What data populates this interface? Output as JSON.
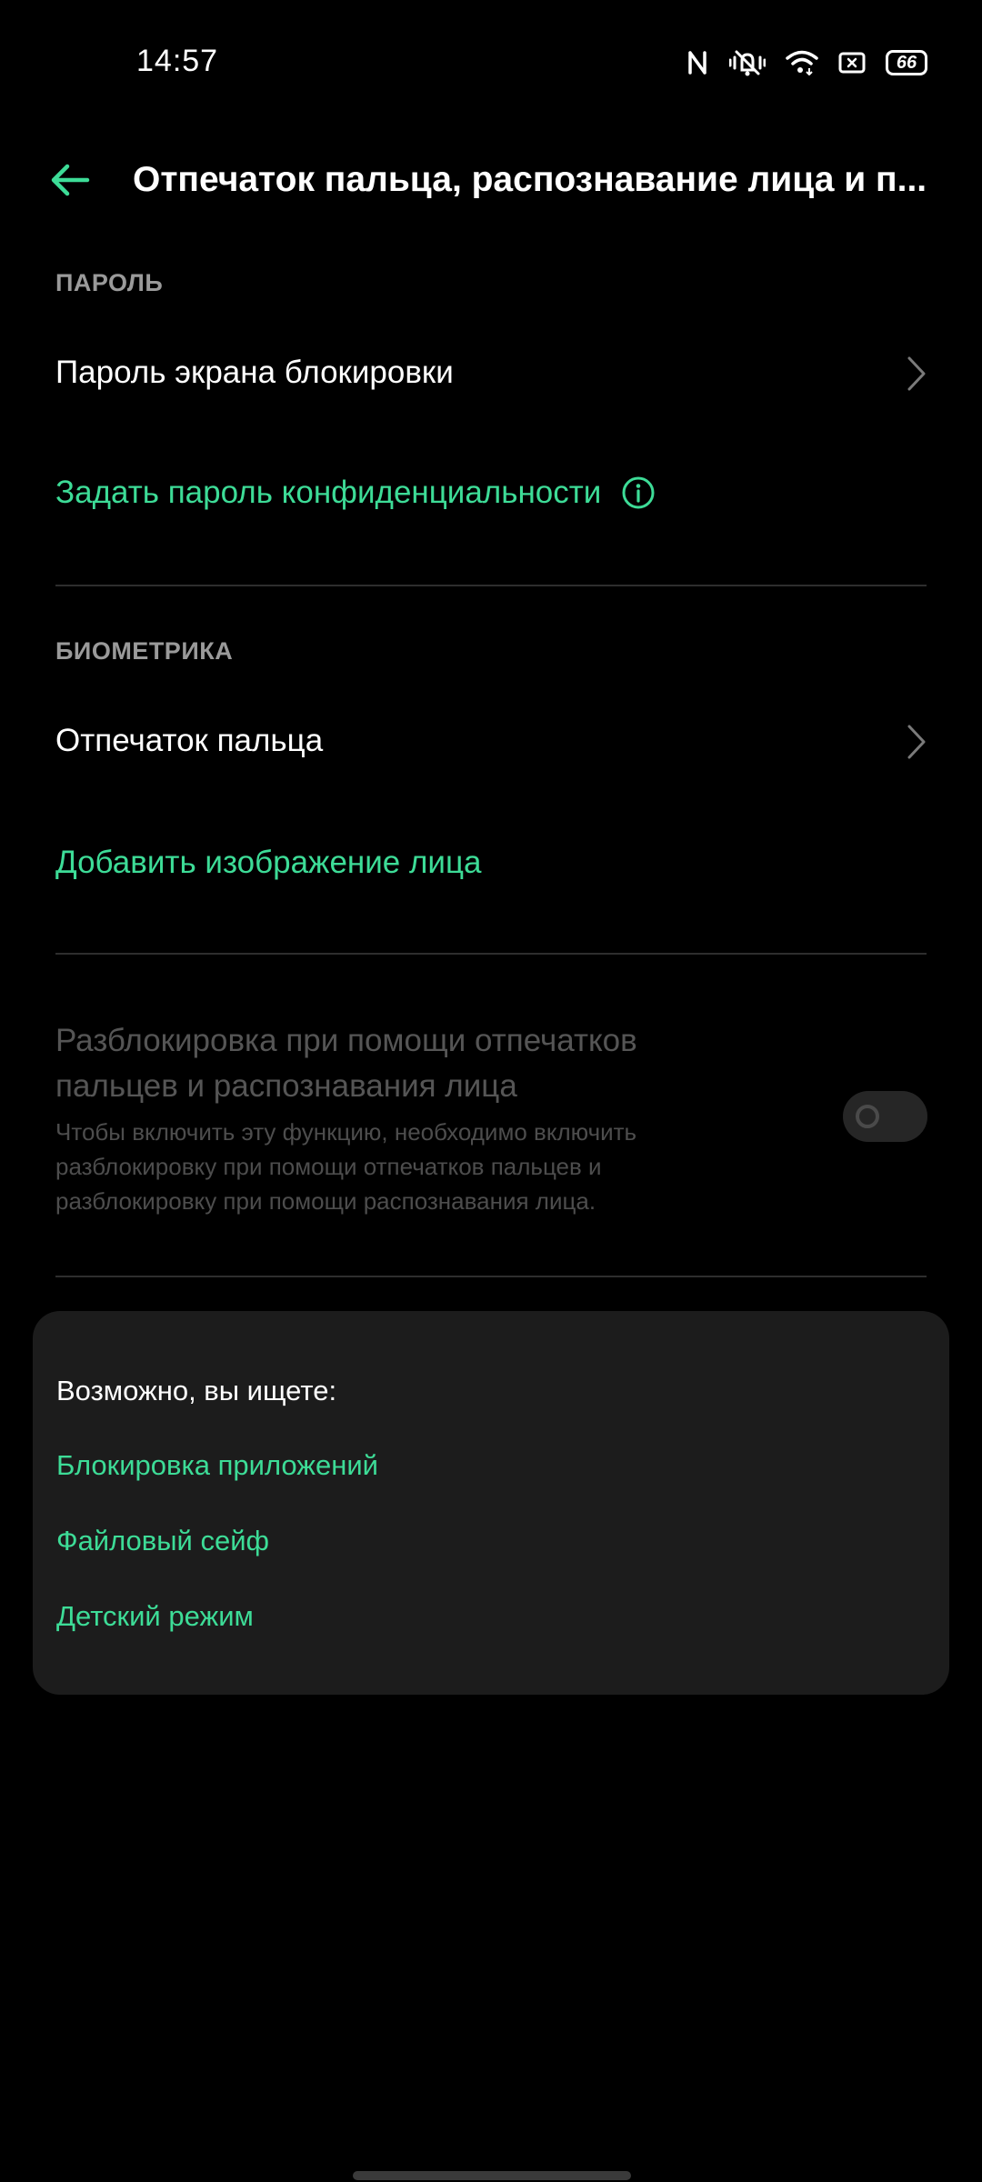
{
  "status_bar": {
    "time": "14:57",
    "battery": "66",
    "icons": [
      "nfc-icon",
      "vibrate-mute-icon",
      "wifi-icon",
      "screenshot-icon",
      "battery-icon"
    ]
  },
  "header": {
    "title": "Отпечаток пальца, распознавание лица и п..."
  },
  "password_section": {
    "header": "ПАРОЛЬ",
    "lock_screen_password": "Пароль экрана блокировки",
    "privacy_password": "Задать пароль конфиденциальности"
  },
  "biometrics_section": {
    "header": "БИОМЕТРИКА",
    "fingerprint": "Отпечаток пальца",
    "add_face": "Добавить изображение лица"
  },
  "combined_unlock": {
    "title": "Разблокировка при помощи отпечатков пальцев и распознавания лица",
    "description": "Чтобы включить эту функцию, необходимо включить разблокировку при помощи отпечатков пальцев и разблокировку при помощи распознавания лица.",
    "enabled": false
  },
  "suggestions": {
    "title": "Возможно, вы ищете:",
    "links": [
      "Блокировка приложений",
      "Файловый сейф",
      "Детский режим"
    ]
  },
  "colors": {
    "accent": "#3ddc97",
    "background": "#000000",
    "card": "#1c1c1c",
    "disabled_text": "#555555"
  }
}
